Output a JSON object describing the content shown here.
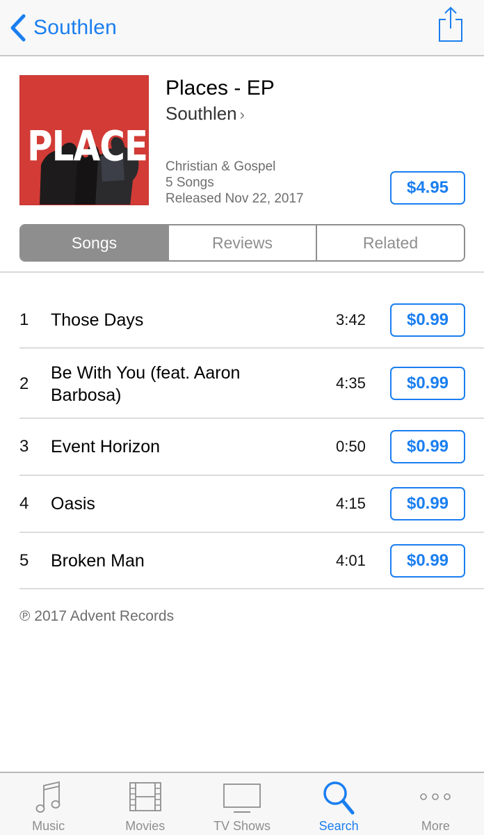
{
  "nav": {
    "back_label": "Southlen",
    "back_icon": "chevron-left-icon",
    "share_icon": "share-icon"
  },
  "album": {
    "cover_text": "PLACES",
    "title": "Places - EP",
    "artist": "Southlen",
    "artist_chevron": "›",
    "genre": "Christian & Gospel",
    "song_count": "5 Songs",
    "released": "Released Nov 22, 2017",
    "price": "$4.95"
  },
  "segments": [
    {
      "label": "Songs",
      "active": true
    },
    {
      "label": "Reviews",
      "active": false
    },
    {
      "label": "Related",
      "active": false
    }
  ],
  "tracks": [
    {
      "number": "1",
      "title": "Those Days",
      "duration": "3:42",
      "price": "$0.99"
    },
    {
      "number": "2",
      "title": "Be With You (feat. Aaron Barbosa)",
      "duration": "4:35",
      "price": "$0.99"
    },
    {
      "number": "3",
      "title": "Event Horizon",
      "duration": "0:50",
      "price": "$0.99"
    },
    {
      "number": "4",
      "title": "Oasis",
      "duration": "4:15",
      "price": "$0.99"
    },
    {
      "number": "5",
      "title": "Broken Man",
      "duration": "4:01",
      "price": "$0.99"
    }
  ],
  "copyright": "℗ 2017 Advent Records",
  "tabbar": [
    {
      "label": "Music",
      "icon": "music-note-icon",
      "active": false
    },
    {
      "label": "Movies",
      "icon": "film-icon",
      "active": false
    },
    {
      "label": "TV Shows",
      "icon": "tv-icon",
      "active": false
    },
    {
      "label": "Search",
      "icon": "search-icon",
      "active": true
    },
    {
      "label": "More",
      "icon": "more-icon",
      "active": false
    }
  ],
  "colors": {
    "accent": "#1a7ef0",
    "segment_active": "#8e8e8e",
    "cover_red": "#d23b36"
  }
}
